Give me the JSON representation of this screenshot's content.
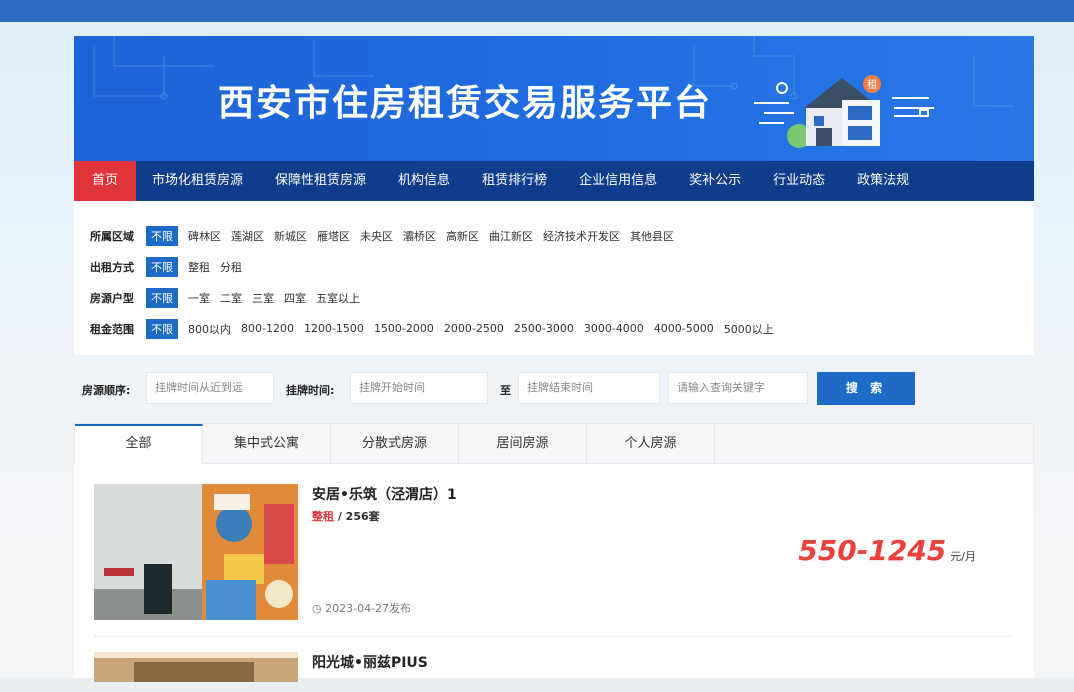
{
  "banner": {
    "title": "西安市住房租赁交易服务平台",
    "badge": "租"
  },
  "nav": [
    "首页",
    "市场化租赁房源",
    "保障性租赁房源",
    "机构信息",
    "租赁排行榜",
    "企业信用信息",
    "奖补公示",
    "行业动态",
    "政策法规"
  ],
  "filters": {
    "area": {
      "label": "所属区域",
      "options": [
        "不限",
        "碑林区",
        "莲湖区",
        "新城区",
        "雁塔区",
        "未央区",
        "灞桥区",
        "高新区",
        "曲江新区",
        "经济技术开发区",
        "其他县区"
      ]
    },
    "rent_type": {
      "label": "出租方式",
      "options": [
        "不限",
        "整租",
        "分租"
      ]
    },
    "layout": {
      "label": "房源户型",
      "options": [
        "不限",
        "一室",
        "二室",
        "三室",
        "四室",
        "五室以上"
      ]
    },
    "price": {
      "label": "租金范围",
      "options": [
        "不限",
        "800以内",
        "800-1200",
        "1200-1500",
        "1500-2000",
        "2000-2500",
        "2500-3000",
        "3000-4000",
        "4000-5000",
        "5000以上"
      ]
    }
  },
  "search": {
    "order_label": "房源顺序:",
    "order_value": "挂牌时间从近到远",
    "time_label": "挂牌时间:",
    "start_placeholder": "挂牌开始时间",
    "to_label": "至",
    "end_placeholder": "挂牌结束时间",
    "keyword_placeholder": "请输入查询关键字",
    "button": "搜 索"
  },
  "tabs": [
    "全部",
    "集中式公寓",
    "分散式房源",
    "居间房源",
    "个人房源"
  ],
  "listings": [
    {
      "title": "安居•乐筑（泾渭店）1",
      "type": "整租",
      "count": " / 256套",
      "date": "2023-04-27发布",
      "price": "550-1245",
      "unit": "元/月"
    },
    {
      "title": "阳光城•丽兹PIUS"
    }
  ]
}
